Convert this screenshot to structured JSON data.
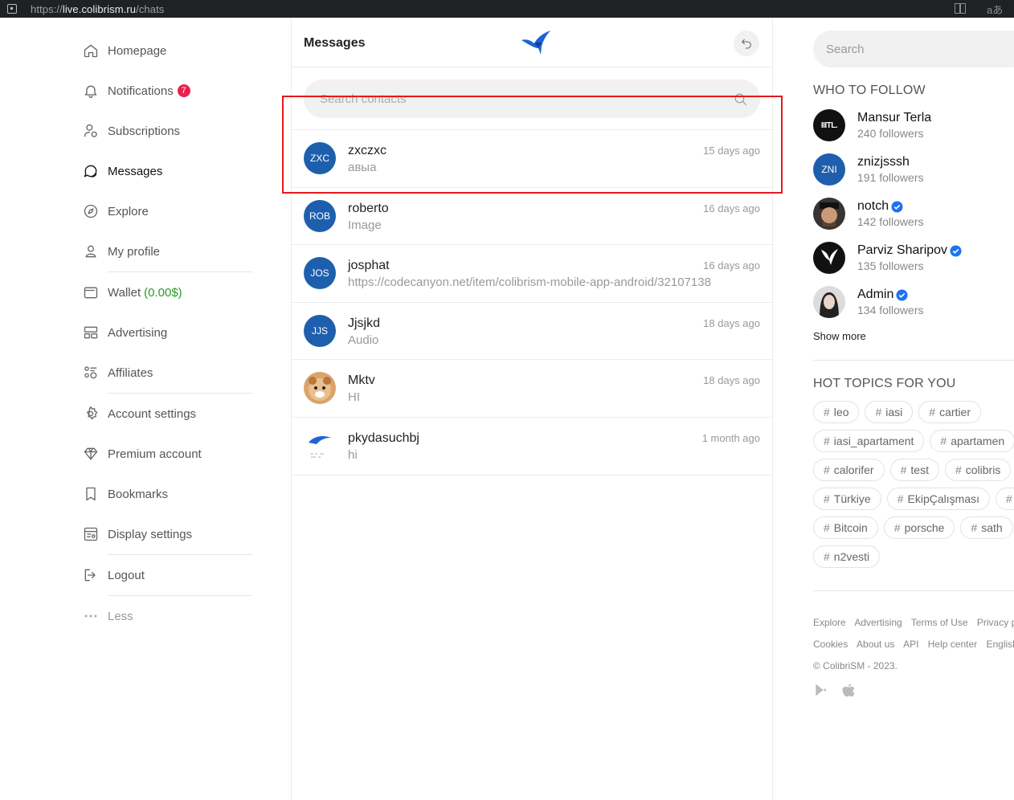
{
  "browser": {
    "url_prefix": "https://",
    "url_host": "live.colibrism.ru",
    "url_path": "/chats",
    "ext_text": "aあ"
  },
  "nav": {
    "items": [
      {
        "label": "Homepage",
        "icon": "home-icon"
      },
      {
        "label": "Notifications",
        "icon": "bell-icon",
        "badge": "7"
      },
      {
        "label": "Subscriptions",
        "icon": "subscriptions-icon"
      },
      {
        "label": "Messages",
        "icon": "messages-icon"
      },
      {
        "label": "Explore",
        "icon": "compass-icon"
      },
      {
        "label": "My profile",
        "icon": "user-icon"
      },
      {
        "label": "Wallet",
        "icon": "wallet-icon",
        "extra": "(0.00$)"
      },
      {
        "label": "Advertising",
        "icon": "advertising-icon"
      },
      {
        "label": "Affiliates",
        "icon": "affiliates-icon"
      },
      {
        "label": "Account settings",
        "icon": "gear-icon"
      },
      {
        "label": "Premium account",
        "icon": "diamond-icon"
      },
      {
        "label": "Bookmarks",
        "icon": "bookmark-icon"
      },
      {
        "label": "Display settings",
        "icon": "display-icon"
      },
      {
        "label": "Logout",
        "icon": "logout-icon"
      },
      {
        "label": "Less",
        "icon": "more-icon"
      }
    ],
    "accent_green": "#2a9a2a",
    "badge_color": "#e8204e"
  },
  "messages": {
    "title": "Messages",
    "search_placeholder": "Search contacts",
    "chats": [
      {
        "initials": "ZXC",
        "name": "zxczxc",
        "preview": "авыа",
        "time": "15 days ago"
      },
      {
        "initials": "ROB",
        "name": "roberto",
        "preview": "Image",
        "time": "16 days ago"
      },
      {
        "initials": "JOS",
        "name": "josphat",
        "preview": "https://codecanyon.net/item/colibrism-mobile-app-android/32107138",
        "time": "16 days ago"
      },
      {
        "initials": "JJS",
        "name": "Jjsjkd",
        "preview": "Audio",
        "time": "18 days ago"
      },
      {
        "initials": "",
        "name": "Mktv",
        "preview": "HI",
        "time": "18 days ago"
      },
      {
        "initials": "",
        "name": "pkydasuchbj",
        "preview": "hi",
        "time": "1 month ago"
      }
    ],
    "highlight_color": "#e5191c",
    "avatar_color": "#1e5fad"
  },
  "right": {
    "search_placeholder": "Search",
    "who_to_follow_title": "WHO TO FOLLOW",
    "follow": [
      {
        "avatar": "IIITL.",
        "name": "Mansur Terla",
        "followers": "240 followers",
        "verified": false
      },
      {
        "avatar": "ZNI",
        "name": "znizjsssh",
        "followers": "191 followers",
        "verified": false
      },
      {
        "avatar": "",
        "name": "notch",
        "followers": "142 followers",
        "verified": true
      },
      {
        "avatar": "",
        "name": "Parviz Sharipov",
        "followers": "135 followers",
        "verified": true
      },
      {
        "avatar": "",
        "name": "Admin",
        "followers": "134 followers",
        "verified": true
      }
    ],
    "show_more": "Show more",
    "hot_topics_title": "HOT TOPICS FOR YOU",
    "tags": [
      "leo",
      "iasi",
      "cartier",
      "iasi_apartament",
      "apartamen",
      "calorifer",
      "test",
      "colibris",
      "Türkiye",
      "EkipÇalışması",
      "",
      "Bitcoin",
      "porsche",
      "sath",
      "n2vesti"
    ],
    "footer_row1": [
      "Explore",
      "Advertising",
      "Terms of Use",
      "Privacy p"
    ],
    "footer_row2": [
      "Cookies",
      "About us",
      "API",
      "Help center",
      "English"
    ],
    "copyright": "© ColibriSM - 2023."
  }
}
